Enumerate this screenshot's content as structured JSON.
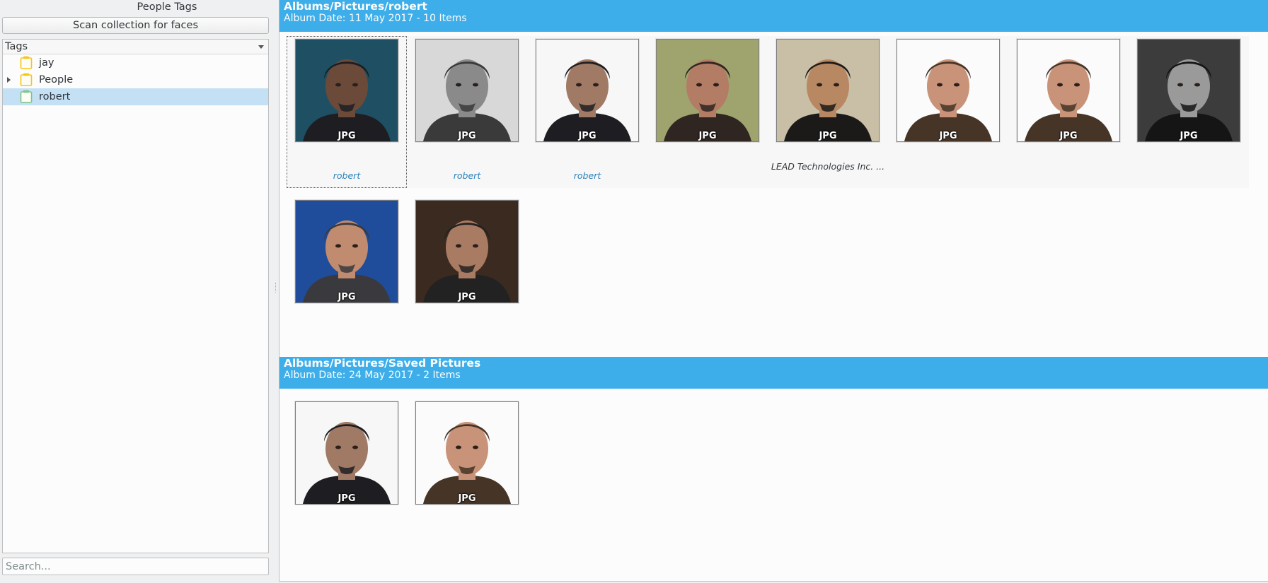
{
  "panel": {
    "title": "People Tags",
    "scan_button": "Scan collection for faces",
    "tree_header": "Tags",
    "search_placeholder": "Search..."
  },
  "tags": [
    {
      "label": "jay",
      "expandable": false,
      "selected": false,
      "icon": "tag-folder-icon",
      "icon_color": "#f5c518"
    },
    {
      "label": "People",
      "expandable": true,
      "selected": false,
      "icon": "tag-folder-icon",
      "icon_color": "#f5c518"
    },
    {
      "label": "robert",
      "expandable": false,
      "selected": true,
      "icon": "tag-folder-icon",
      "icon_color": "#7fc48a"
    }
  ],
  "albums": [
    {
      "title": "Albums/Pictures/robert",
      "subtitle": "Album Date: 11 May 2017 - 10 Items",
      "items": [
        {
          "badge": "JPG",
          "tag": "robert",
          "note": "",
          "tone": "dark-teal"
        },
        {
          "badge": "JPG",
          "tag": "robert",
          "note": "",
          "tone": "grey"
        },
        {
          "badge": "JPG",
          "tag": "robert",
          "note": "",
          "tone": "white"
        },
        {
          "badge": "JPG",
          "tag": "",
          "note": "",
          "tone": "warm"
        },
        {
          "badge": "JPG",
          "tag": "",
          "note": "LEAD Technologies Inc. ...",
          "tone": "warm-dark"
        },
        {
          "badge": "JPG",
          "tag": "",
          "note": "",
          "tone": "light"
        },
        {
          "badge": "JPG",
          "tag": "",
          "note": "",
          "tone": "light"
        },
        {
          "badge": "JPG",
          "tag": "",
          "note": "",
          "tone": "mono"
        },
        {
          "badge": "JPG",
          "tag": "",
          "note": "",
          "tone": "blue"
        },
        {
          "badge": "JPG",
          "tag": "",
          "note": "",
          "tone": "brown"
        }
      ]
    },
    {
      "title": "Albums/Pictures/Saved Pictures",
      "subtitle": "Album Date: 24 May 2017 - 2 Items",
      "items": [
        {
          "badge": "JPG",
          "tag": "",
          "note": "",
          "tone": "white"
        },
        {
          "badge": "JPG",
          "tag": "",
          "note": "",
          "tone": "light"
        }
      ]
    }
  ],
  "colors": {
    "accent": "#3daee9",
    "selection": "#c3e0f5",
    "tag_text": "#2980b9"
  }
}
